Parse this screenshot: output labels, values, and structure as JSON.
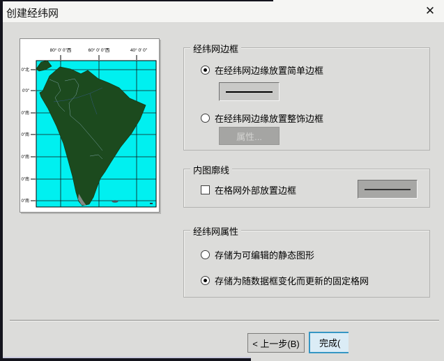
{
  "window": {
    "title": "创建经纬网"
  },
  "icons": {
    "close": "✕"
  },
  "preview": {
    "top_labels": [
      "80° 0' 0\"西",
      "60° 0' 0\"西",
      "40° 0' 0\""
    ],
    "left_labels": [
      "0\"北",
      "0'0\"",
      "0\"南",
      "0\"南",
      "0\"南",
      "0\"南",
      "0\"南"
    ],
    "colors": {
      "ocean": "#00f0f0",
      "land": "#1c4a1e"
    }
  },
  "groups": {
    "border": {
      "title": "经纬网边框",
      "radio_simple": {
        "label": "在经纬网边缘放置简单边框",
        "selected": true
      },
      "radio_decorative": {
        "label": "在经纬网边缘放置整饰边框",
        "selected": false
      },
      "properties_button": "属性..."
    },
    "neatline": {
      "title": "内图廓线",
      "checkbox": {
        "label": "在格网外部放置边框",
        "checked": false
      }
    },
    "properties": {
      "title": "经纬网属性",
      "radio_static": {
        "label": "存储为可编辑的静态图形",
        "selected": false
      },
      "radio_fixed": {
        "label": "存储为随数据框变化而更新的固定格网",
        "selected": true
      }
    }
  },
  "footer": {
    "back_button": "< 上一步(B)",
    "finish_button": "完成("
  }
}
